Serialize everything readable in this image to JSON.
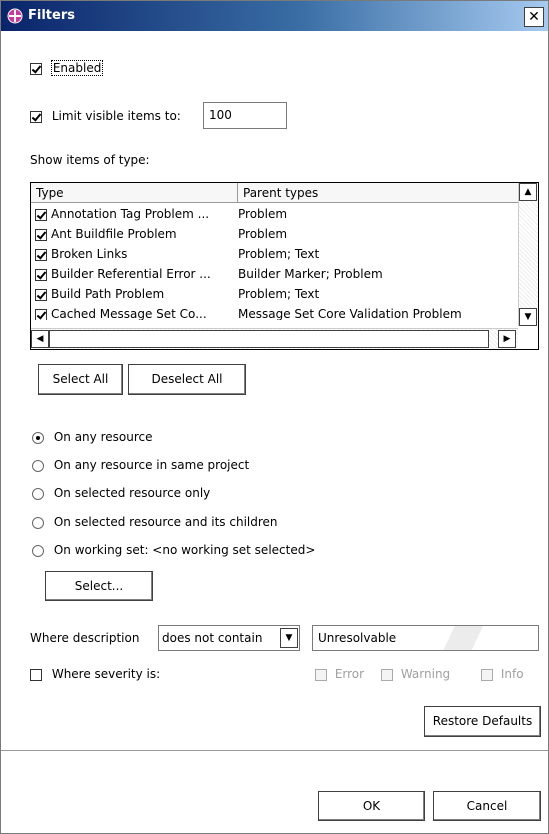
{
  "window": {
    "title": "Filters",
    "close_glyph": "✕"
  },
  "enabled": {
    "label": "Enabled",
    "checked": true
  },
  "limit": {
    "label": "Limit visible items to:",
    "checked": true,
    "value": "100"
  },
  "types_section": {
    "label": "Show items of type:"
  },
  "table": {
    "columns": [
      "Type",
      "Parent types"
    ],
    "rows": [
      {
        "type": "Annotation Tag Problem ...",
        "parent": "Problem"
      },
      {
        "type": "Ant Buildfile Problem",
        "parent": "Problem"
      },
      {
        "type": "Broken Links",
        "parent": "Problem; Text"
      },
      {
        "type": "Builder Referential Error ...",
        "parent": "Builder Marker; Problem"
      },
      {
        "type": "Build Path Problem",
        "parent": "Problem; Text"
      },
      {
        "type": "Cached Message Set Co...",
        "parent": "Message Set Core Validation Problem"
      }
    ]
  },
  "buttons": {
    "select_all": "Select All",
    "deselect_all": "Deselect All",
    "select": "Select...",
    "restore_defaults": "Restore Defaults",
    "ok": "OK",
    "cancel": "Cancel"
  },
  "scope": {
    "any_resource": "On any resource",
    "same_project": "On any resource in same project",
    "selected_only": "On selected resource only",
    "selected_children": "On selected resource and its children",
    "working_set": "On working set:  <no working set selected>",
    "selected_option": "On any resource"
  },
  "description": {
    "label": "Where description",
    "operator": "does not contain",
    "value": "Unresolvable"
  },
  "severity": {
    "label": "Where severity is:",
    "checked": false,
    "error": "Error",
    "warning": "Warning",
    "info": "Info"
  }
}
